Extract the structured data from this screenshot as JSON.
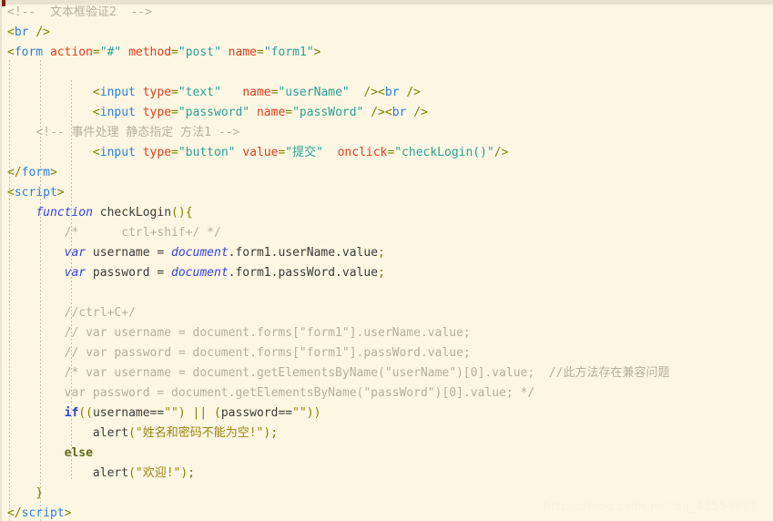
{
  "editor": {
    "language": "HTML/JavaScript",
    "background_color": "#fdf6e3",
    "watermark": "https://blog.csdn.net/qq_43554951",
    "colors": {
      "comment": "#b5b09a",
      "tag": "#2b7fd4",
      "attribute": "#d9411e",
      "attribute_value": "#2aa198",
      "keyword": "#3344dd",
      "punctuation": "#808000",
      "string": "#9a8512",
      "plain_text": "#3b3b38",
      "background": "#fdf6e3",
      "marker": "#8b1a1a"
    }
  },
  "code_lines": [
    {
      "n": 1,
      "tokens": [
        {
          "t": "comment",
          "v": "<!--  文本框验证2  -->"
        }
      ]
    },
    {
      "n": 2,
      "tokens": [
        {
          "t": "punct",
          "v": "<"
        },
        {
          "t": "tag",
          "v": "br"
        },
        {
          "t": "plain",
          "v": " "
        },
        {
          "t": "punct",
          "v": "/>"
        }
      ]
    },
    {
      "n": 3,
      "tokens": [
        {
          "t": "punct",
          "v": "<"
        },
        {
          "t": "tag",
          "v": "form"
        },
        {
          "t": "plain",
          "v": " "
        },
        {
          "t": "attr",
          "v": "action"
        },
        {
          "t": "punct",
          "v": "="
        },
        {
          "t": "str",
          "v": "\"#\""
        },
        {
          "t": "plain",
          "v": " "
        },
        {
          "t": "attr",
          "v": "method"
        },
        {
          "t": "punct",
          "v": "="
        },
        {
          "t": "str",
          "v": "\"post\""
        },
        {
          "t": "plain",
          "v": " "
        },
        {
          "t": "attr",
          "v": "name"
        },
        {
          "t": "punct",
          "v": "="
        },
        {
          "t": "str",
          "v": "\"form1\""
        },
        {
          "t": "punct",
          "v": ">"
        }
      ]
    },
    {
      "n": 4,
      "tokens": []
    },
    {
      "n": 5,
      "tokens": [
        {
          "t": "plain",
          "v": "            "
        },
        {
          "t": "punct",
          "v": "<"
        },
        {
          "t": "tag",
          "v": "input"
        },
        {
          "t": "plain",
          "v": " "
        },
        {
          "t": "attr",
          "v": "type"
        },
        {
          "t": "punct",
          "v": "="
        },
        {
          "t": "str",
          "v": "\"text\""
        },
        {
          "t": "plain",
          "v": "   "
        },
        {
          "t": "attr",
          "v": "name"
        },
        {
          "t": "punct",
          "v": "="
        },
        {
          "t": "str",
          "v": "\"userName\""
        },
        {
          "t": "plain",
          "v": "  "
        },
        {
          "t": "punct",
          "v": "/>"
        },
        {
          "t": "punct",
          "v": "<"
        },
        {
          "t": "tag",
          "v": "br"
        },
        {
          "t": "plain",
          "v": " "
        },
        {
          "t": "punct",
          "v": "/>"
        }
      ]
    },
    {
      "n": 6,
      "tokens": [
        {
          "t": "plain",
          "v": "            "
        },
        {
          "t": "punct",
          "v": "<"
        },
        {
          "t": "tag",
          "v": "input"
        },
        {
          "t": "plain",
          "v": " "
        },
        {
          "t": "attr",
          "v": "type"
        },
        {
          "t": "punct",
          "v": "="
        },
        {
          "t": "str",
          "v": "\"password\""
        },
        {
          "t": "plain",
          "v": " "
        },
        {
          "t": "attr",
          "v": "name"
        },
        {
          "t": "punct",
          "v": "="
        },
        {
          "t": "str",
          "v": "\"passWord\""
        },
        {
          "t": "plain",
          "v": " "
        },
        {
          "t": "punct",
          "v": "/>"
        },
        {
          "t": "punct",
          "v": "<"
        },
        {
          "t": "tag",
          "v": "br"
        },
        {
          "t": "plain",
          "v": " "
        },
        {
          "t": "punct",
          "v": "/>"
        }
      ]
    },
    {
      "n": 7,
      "tokens": [
        {
          "t": "plain",
          "v": "    "
        },
        {
          "t": "comment",
          "v": "<!-- 事件处理 静态指定 方法1 -->"
        }
      ]
    },
    {
      "n": 8,
      "tokens": [
        {
          "t": "plain",
          "v": "            "
        },
        {
          "t": "punct",
          "v": "<"
        },
        {
          "t": "tag",
          "v": "input"
        },
        {
          "t": "plain",
          "v": " "
        },
        {
          "t": "attr",
          "v": "type"
        },
        {
          "t": "punct",
          "v": "="
        },
        {
          "t": "str",
          "v": "\"button\""
        },
        {
          "t": "plain",
          "v": " "
        },
        {
          "t": "attr",
          "v": "value"
        },
        {
          "t": "punct",
          "v": "="
        },
        {
          "t": "str",
          "v": "\"提交\""
        },
        {
          "t": "plain",
          "v": "  "
        },
        {
          "t": "attr",
          "v": "onclick"
        },
        {
          "t": "punct",
          "v": "="
        },
        {
          "t": "str",
          "v": "\"checkLogin()\""
        },
        {
          "t": "punct",
          "v": "/>"
        }
      ]
    },
    {
      "n": 9,
      "tokens": [
        {
          "t": "punct",
          "v": "</"
        },
        {
          "t": "tag",
          "v": "form"
        },
        {
          "t": "punct",
          "v": ">"
        }
      ]
    },
    {
      "n": 10,
      "tokens": [
        {
          "t": "punct",
          "v": "<"
        },
        {
          "t": "tag",
          "v": "script"
        },
        {
          "t": "punct",
          "v": ">"
        }
      ]
    },
    {
      "n": 11,
      "tokens": [
        {
          "t": "plain",
          "v": "    "
        },
        {
          "t": "kw",
          "v": "function"
        },
        {
          "t": "plain",
          "v": " checkLogin"
        },
        {
          "t": "paren",
          "v": "()"
        },
        {
          "t": "paren",
          "v": "{"
        }
      ]
    },
    {
      "n": 12,
      "tokens": [
        {
          "t": "plain",
          "v": "        "
        },
        {
          "t": "comment",
          "v": "/*      ctrl+shif+/ */"
        }
      ]
    },
    {
      "n": 13,
      "tokens": [
        {
          "t": "plain",
          "v": "        "
        },
        {
          "t": "kw",
          "v": "var"
        },
        {
          "t": "plain",
          "v": " username = "
        },
        {
          "t": "kw",
          "v": "document"
        },
        {
          "t": "plain",
          "v": ".form1.userName.value"
        },
        {
          "t": "paren",
          "v": ";"
        }
      ]
    },
    {
      "n": 14,
      "tokens": [
        {
          "t": "plain",
          "v": "        "
        },
        {
          "t": "kw",
          "v": "var"
        },
        {
          "t": "plain",
          "v": " password = "
        },
        {
          "t": "kw",
          "v": "document"
        },
        {
          "t": "plain",
          "v": ".form1.passWord.value"
        },
        {
          "t": "paren",
          "v": ";"
        }
      ]
    },
    {
      "n": 15,
      "tokens": []
    },
    {
      "n": 16,
      "tokens": [
        {
          "t": "plain",
          "v": "        "
        },
        {
          "t": "comment",
          "v": "//ctrl+C+/"
        }
      ]
    },
    {
      "n": 17,
      "tokens": [
        {
          "t": "plain",
          "v": "        "
        },
        {
          "t": "comment",
          "v": "// var username = document.forms[\"form1\"].userName.value;"
        }
      ]
    },
    {
      "n": 18,
      "tokens": [
        {
          "t": "plain",
          "v": "        "
        },
        {
          "t": "comment",
          "v": "// var password = document.forms[\"form1\"].passWord.value;"
        }
      ]
    },
    {
      "n": 19,
      "tokens": [
        {
          "t": "plain",
          "v": "        "
        },
        {
          "t": "comment",
          "v": "/* var username = document.getElementsByName(\"userName\")[0].value;  //此方法存在兼容问题"
        }
      ]
    },
    {
      "n": 20,
      "tokens": [
        {
          "t": "plain",
          "v": "        "
        },
        {
          "t": "comment",
          "v": "var password = document.getElementsByName(\"passWord\")[0].value; */"
        }
      ]
    },
    {
      "n": 21,
      "tokens": [
        {
          "t": "plain",
          "v": "        "
        },
        {
          "t": "kw-b",
          "v": "if"
        },
        {
          "t": "paren",
          "v": "(("
        },
        {
          "t": "plain",
          "v": "username=="
        },
        {
          "t": "jsstr",
          "v": "\"\""
        },
        {
          "t": "paren",
          "v": ")"
        },
        {
          "t": "plain",
          "v": " "
        },
        {
          "t": "paren",
          "v": "||"
        },
        {
          "t": "plain",
          "v": " "
        },
        {
          "t": "paren",
          "v": "("
        },
        {
          "t": "plain",
          "v": "password=="
        },
        {
          "t": "jsstr",
          "v": "\"\""
        },
        {
          "t": "paren",
          "v": "))"
        }
      ]
    },
    {
      "n": 22,
      "tokens": [
        {
          "t": "plain",
          "v": "            alert"
        },
        {
          "t": "paren",
          "v": "("
        },
        {
          "t": "jsstr",
          "v": "\"姓名和密码不能为空!\""
        },
        {
          "t": "paren",
          "v": ");"
        }
      ]
    },
    {
      "n": 23,
      "tokens": [
        {
          "t": "plain",
          "v": "        "
        },
        {
          "t": "else",
          "v": "else"
        }
      ]
    },
    {
      "n": 24,
      "tokens": [
        {
          "t": "plain",
          "v": "            alert"
        },
        {
          "t": "paren",
          "v": "("
        },
        {
          "t": "jsstr",
          "v": "\"欢迎!\""
        },
        {
          "t": "paren",
          "v": ");"
        }
      ]
    },
    {
      "n": 25,
      "tokens": [
        {
          "t": "plain",
          "v": "    "
        },
        {
          "t": "paren",
          "v": "}"
        }
      ]
    },
    {
      "n": 26,
      "tokens": [
        {
          "t": "punct",
          "v": "</"
        },
        {
          "t": "tag",
          "v": "script"
        },
        {
          "t": "punct",
          "v": ">"
        }
      ]
    }
  ]
}
